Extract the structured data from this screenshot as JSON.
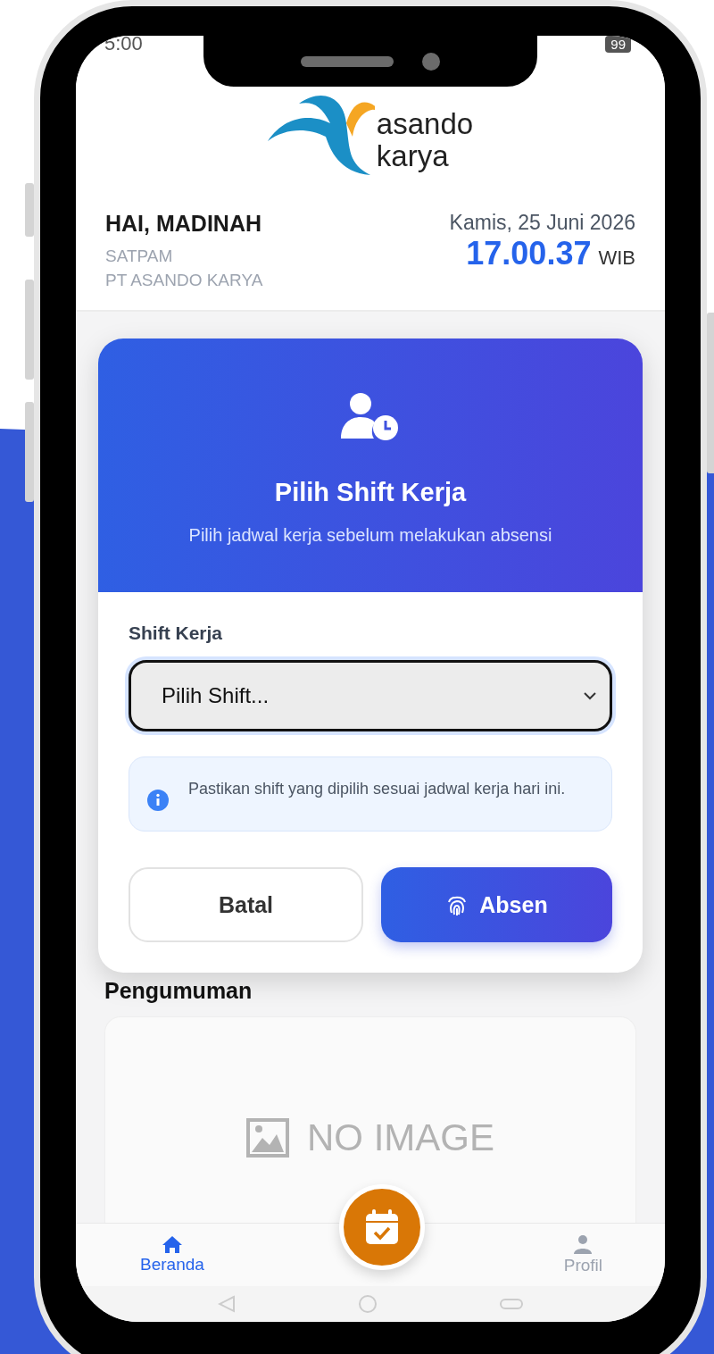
{
  "status_bar": {
    "time": "5:00",
    "battery": "99"
  },
  "logo": {
    "line_1": "asando",
    "line_2": "karya"
  },
  "header": {
    "greeting": "HAI, MADINAH",
    "role": "SATPAM",
    "company": "PT ASANDO KARYA",
    "date": "Kamis, 25 Juni 2026",
    "time": "17.00.37",
    "timezone": "WIB"
  },
  "modal": {
    "title": "Pilih Shift Kerja",
    "subtitle": "Pilih jadwal kerja sebelum melakukan absensi",
    "field_label": "Shift Kerja",
    "select": {
      "placeholder": "Pilih Shift..."
    },
    "info": "Pastikan shift yang dipilih sesuai jadwal kerja hari ini.",
    "buttons": [
      {
        "label": "Batal",
        "kind": "secondary"
      },
      {
        "label": "Absen",
        "kind": "primary"
      }
    ]
  },
  "announcements": {
    "title": "Pengumuman",
    "image_text": "NO IMAGE"
  },
  "bottom_nav": [
    {
      "label": "Beranda",
      "kind": "home",
      "selected": true
    },
    {
      "label": "Profil",
      "kind": "profile",
      "selected": false
    }
  ]
}
